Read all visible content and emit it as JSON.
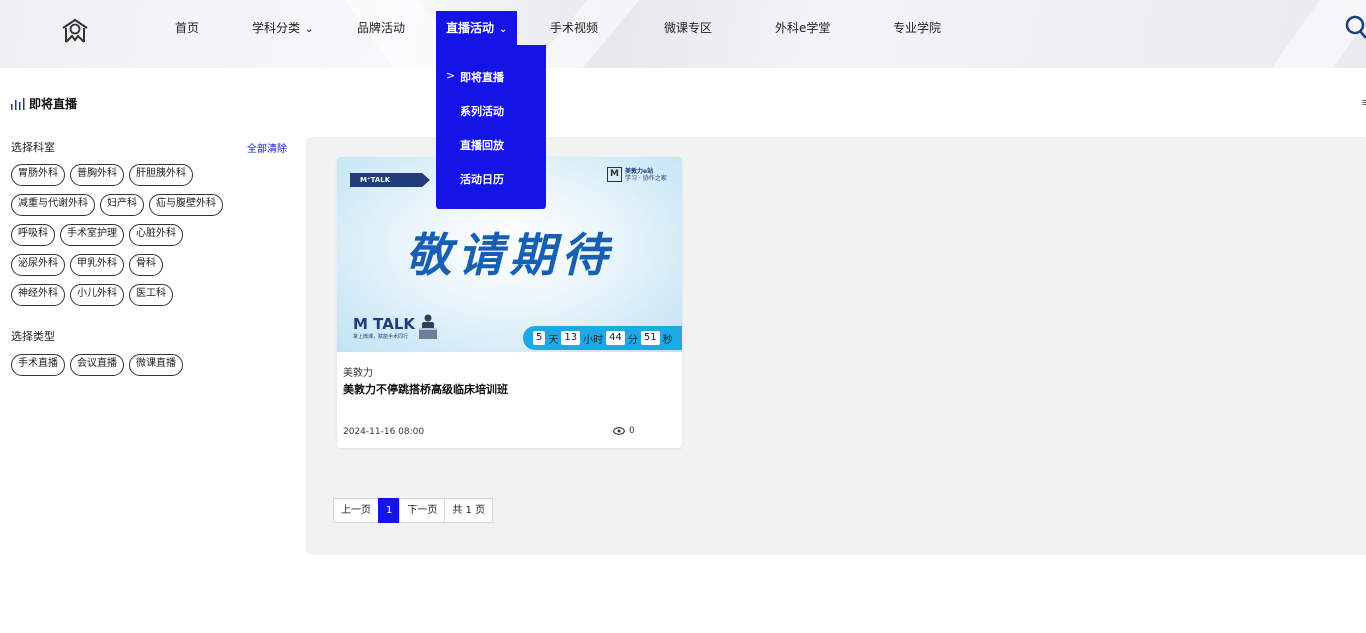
{
  "nav": {
    "items": [
      {
        "label": "首页"
      },
      {
        "label": "学科分类"
      },
      {
        "label": "品牌活动"
      },
      {
        "label": "直播活动"
      },
      {
        "label": "手术视频"
      },
      {
        "label": "微课专区"
      },
      {
        "label": "外科e学堂"
      },
      {
        "label": "专业学院"
      }
    ],
    "active_index": 3,
    "dropdown": [
      "即将直播",
      "系列活动",
      "直播回放",
      "活动日历"
    ],
    "dropdown_arrow": ">",
    "chevron": "⌄",
    "colors": {
      "accent": "#1414e6"
    }
  },
  "page": {
    "title": "即将直播",
    "edge_mark": "≡"
  },
  "sidebar": {
    "dept_label": "选择科室",
    "clear_all": "全部清除",
    "dept_tags": [
      [
        "胃肠外科",
        "普胸外科",
        "肝胆胰外科"
      ],
      [
        "减重与代谢外科",
        "妇产科",
        "疝与腹壁外科"
      ],
      [
        "呼吸科",
        "手术室护理",
        "心脏外科"
      ],
      [
        "泌尿外科",
        "甲乳外科",
        "骨科"
      ],
      [
        "神经外科",
        "小儿外科",
        "医工科"
      ]
    ],
    "type_label": "选择类型",
    "type_tags": [
      "手术直播",
      "会议直播",
      "微课直播"
    ]
  },
  "card": {
    "banner_tag": "M⁺TALK",
    "brand_letter": "M",
    "brand_text_1": "美敦力e站",
    "brand_text_2": "学习 · 协作之家",
    "headline": "敬请期待",
    "mtalk_logo": "M TALK",
    "mtalk_sub": "掌上微课，赋能手术同行",
    "countdown": {
      "days": "5",
      "days_unit": "天",
      "hours": "13",
      "hours_unit": "小时",
      "minutes": "44",
      "minutes_unit": "分",
      "seconds": "51",
      "seconds_unit": "秒"
    },
    "author": "美敦力",
    "title": "美敦力不停跳搭桥高级临床培训班",
    "date": "2024-11-16 08:00",
    "views": "0"
  },
  "pagination": {
    "prev": "上一页",
    "current": "1",
    "next": "下一页",
    "total": "共 1 页"
  }
}
